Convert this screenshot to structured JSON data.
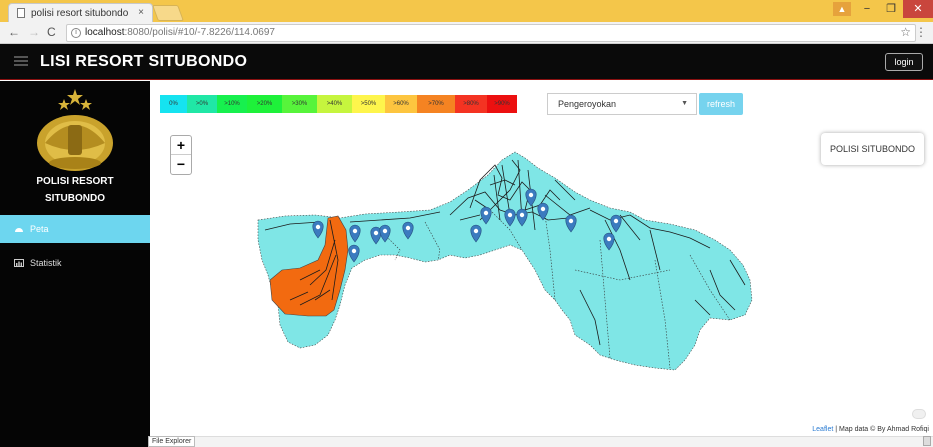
{
  "browser": {
    "tab_title": "polisi resort situbondo",
    "tab_close": "×",
    "url_host": "localhost",
    "url_rest": ":8080/polisi/#10/-7.8226/114.0697"
  },
  "header": {
    "title": "LISI RESORT SITUBONDO",
    "login_label": "login"
  },
  "sidebar": {
    "brand_line1": "POLISI RESORT",
    "brand_line2": "SITUBONDO",
    "items": [
      {
        "label": "Peta",
        "icon": "dashboard-icon"
      },
      {
        "label": "Statistik",
        "icon": "chart-icon"
      }
    ]
  },
  "legend": {
    "items": [
      {
        "label": "0%",
        "color": "#15e3f0"
      },
      {
        "label": ">0%",
        "color": "#20e7a6"
      },
      {
        "label": ">10%",
        "color": "#17f04e"
      },
      {
        "label": ">20%",
        "color": "#1ef13a"
      },
      {
        "label": ">30%",
        "color": "#57f43b"
      },
      {
        "label": ">40%",
        "color": "#c6f53e"
      },
      {
        "label": ">50%",
        "color": "#fef54c"
      },
      {
        "label": ">60%",
        "color": "#fdc53f"
      },
      {
        "label": ">70%",
        "color": "#f58322"
      },
      {
        "label": ">80%",
        "color": "#f43322"
      },
      {
        "label": ">90%",
        "color": "#ec1010"
      }
    ]
  },
  "filter": {
    "selected": "Pengeroyokan",
    "refresh_label": "refresh"
  },
  "map": {
    "info_label": "POLISI SITUBONDO",
    "attribution_link": "Leaflet",
    "attribution_text": " | Map data © By Ahmad Rofiqi",
    "zoom_in": "+",
    "zoom_out": "−",
    "region_color": "#7fe6e6",
    "highlight_color": "#f26a10",
    "marker_color": "#3b7bbf"
  },
  "taskbar": {
    "file_explorer": "File Explorer"
  }
}
